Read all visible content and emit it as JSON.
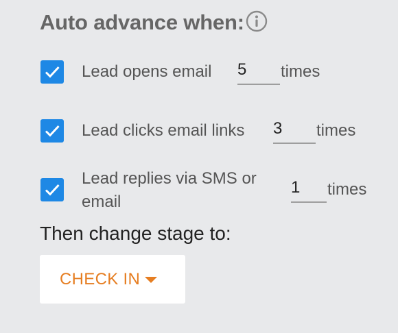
{
  "heading": "Auto advance when:",
  "icons": {
    "info": "info-circle-icon",
    "check": "checkmark-icon",
    "caret": "caret-down-icon"
  },
  "rules": [
    {
      "label": "Lead opens email",
      "value": "5",
      "unit": "times",
      "checked": true
    },
    {
      "label": "Lead clicks email links",
      "value": "3",
      "unit": "times",
      "checked": true
    },
    {
      "label": "Lead replies via SMS or email",
      "value": "1",
      "unit": "times",
      "checked": true
    }
  ],
  "then_label": "Then change stage to:",
  "stage": {
    "selected": "CHECK IN"
  },
  "colors": {
    "background": "#e8e9eb",
    "checkbox": "#1e88e5",
    "accent": "#e67e22"
  }
}
